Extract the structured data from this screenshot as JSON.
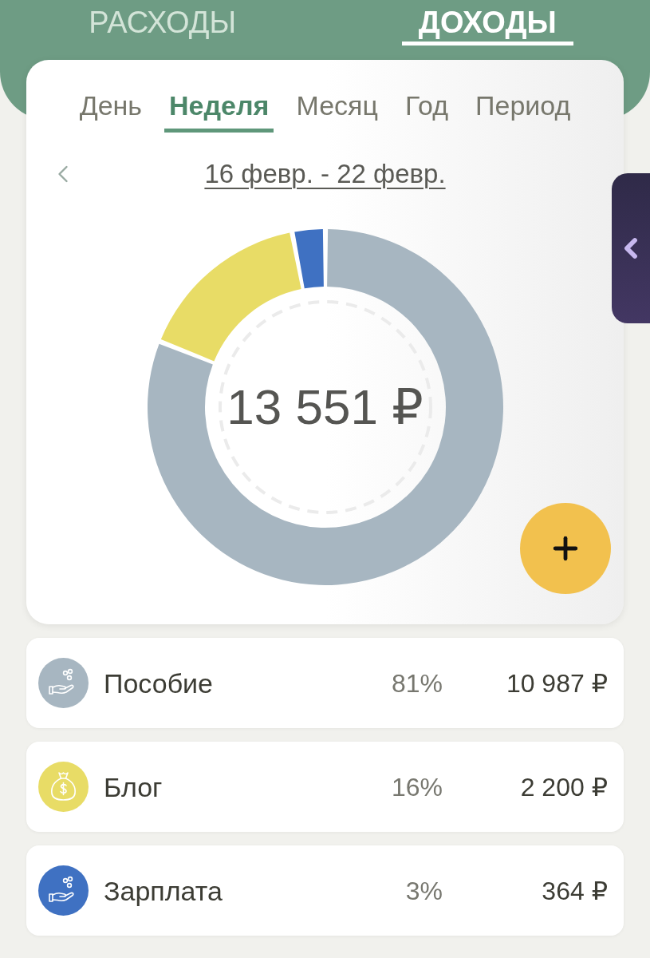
{
  "top_tabs": [
    {
      "label": "РАСХОДЫ",
      "selected": false
    },
    {
      "label": "ДОХОДЫ",
      "selected": true
    }
  ],
  "period_tabs": [
    {
      "label": "День",
      "selected": false
    },
    {
      "label": "Неделя",
      "selected": true
    },
    {
      "label": "Месяц",
      "selected": false
    },
    {
      "label": "Год",
      "selected": false
    },
    {
      "label": "Период",
      "selected": false
    }
  ],
  "date_range": {
    "label": "16 февр. - 22 февр."
  },
  "chart": {
    "total": "13 551 ₽",
    "chart_data": {
      "type": "donut",
      "values": [
        81,
        16,
        3
      ]
    }
  },
  "items": [
    {
      "kind": "hand-coins",
      "name": "Пособие",
      "percent": "81%",
      "amount": "10 987 ₽",
      "color": "#a7b6c1"
    },
    {
      "kind": "money-bag",
      "name": "Блог",
      "percent": "16%",
      "amount": "2 200 ₽",
      "color": "#e8dc66"
    },
    {
      "kind": "hand-coins",
      "name": "Зарплата",
      "percent": "3%",
      "amount": "364 ₽",
      "color": "#3f71c2"
    }
  ]
}
